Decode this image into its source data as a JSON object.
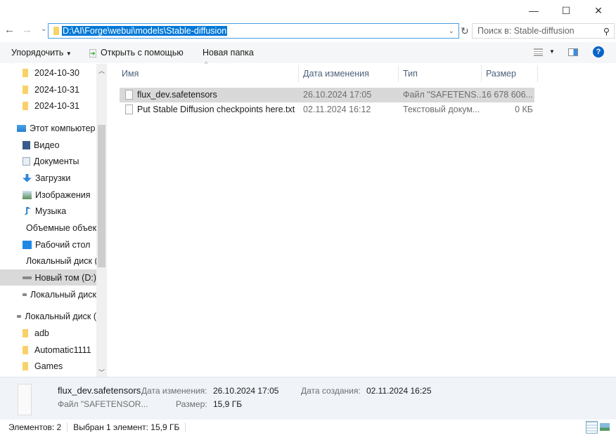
{
  "window": {
    "minimize": "—",
    "maximize": "☐",
    "close": "✕"
  },
  "nav": {
    "back": "←",
    "forward": "→",
    "recent": "⌄",
    "address": "D:\\AI\\Forge\\webui\\models\\Stable-diffusion",
    "refresh": "↻",
    "search_placeholder": "Поиск в: Stable-diffusion"
  },
  "toolbar": {
    "organize": "Упорядочить",
    "open_with": "Открыть с помощью",
    "new_folder": "Новая папка"
  },
  "sidebar": {
    "items": [
      {
        "label": "2024-10-30",
        "icon": "folder"
      },
      {
        "label": "2024-10-31",
        "icon": "folder"
      },
      {
        "label": "2024-10-31",
        "icon": "folder"
      },
      {
        "label": "Этот компьютер",
        "icon": "computer"
      },
      {
        "label": "Видео",
        "icon": "video"
      },
      {
        "label": "Документы",
        "icon": "documents"
      },
      {
        "label": "Загрузки",
        "icon": "downloads"
      },
      {
        "label": "Изображения",
        "icon": "pictures"
      },
      {
        "label": "Музыка",
        "icon": "music"
      },
      {
        "label": "Объемные объекты",
        "icon": "3d-objects"
      },
      {
        "label": "Рабочий стол",
        "icon": "desktop"
      },
      {
        "label": "Локальный диск (C:)",
        "icon": "system-drive"
      },
      {
        "label": "Новый том (D:)",
        "icon": "drive",
        "selected": true
      },
      {
        "label": "Локальный диск",
        "icon": "drive"
      },
      {
        "label": "Локальный диск (",
        "icon": "drive"
      },
      {
        "label": "adb",
        "icon": "folder"
      },
      {
        "label": "Automatic1111",
        "icon": "folder"
      },
      {
        "label": "Games",
        "icon": "folder"
      }
    ]
  },
  "columns": {
    "name": "Имя",
    "date": "Дата изменения",
    "type": "Тип",
    "size": "Размер"
  },
  "files": [
    {
      "name": "flux_dev.safetensors",
      "date": "26.10.2024 17:05",
      "type": "Файл \"SAFETENS...",
      "size": "16 678 606...",
      "selected": true
    },
    {
      "name": "Put Stable Diffusion checkpoints here.txt",
      "date": "02.11.2024 16:12",
      "type": "Текстовый докум...",
      "size": "0 КБ"
    }
  ],
  "details": {
    "name": "flux_dev.safetensors",
    "type": "Файл \"SAFETENSOR...",
    "modified_label": "Дата изменения:",
    "modified": "26.10.2024 17:05",
    "size_label": "Размер:",
    "size": "15,9 ГБ",
    "created_label": "Дата создания:",
    "created": "02.11.2024 16:25"
  },
  "status": {
    "count": "Элементов: 2",
    "selected": "Выбран 1 элемент: 15,9 ГБ"
  }
}
